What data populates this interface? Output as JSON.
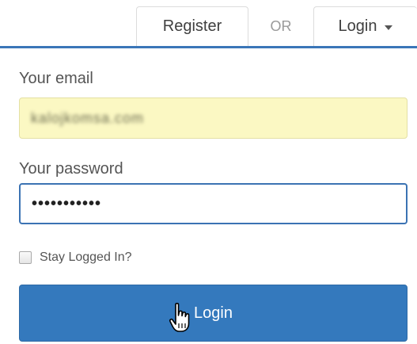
{
  "tabs": {
    "register_label": "Register",
    "separator_label": "OR",
    "login_label": "Login"
  },
  "form": {
    "email_label": "Your email",
    "email_value": "kalojkomsa.com",
    "password_label": "Your password",
    "password_value": "•••••••••••",
    "remember_label": "Stay Logged In?",
    "remember_checked": false,
    "submit_label": "Login"
  },
  "colors": {
    "accent": "#3479bd",
    "autofill": "#fbf8c3"
  },
  "icons": {
    "tab_caret": "chevron-down-icon",
    "pointer": "hand-pointer-icon"
  }
}
